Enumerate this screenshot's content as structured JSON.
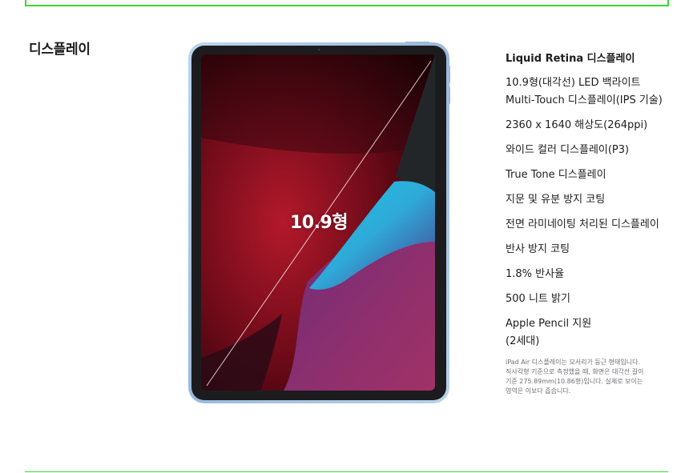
{
  "section": {
    "title": "디스플레이"
  },
  "illustration": {
    "size_label": "10.9형",
    "device_frame_color": "#a9c6e2",
    "bezel_color": "#1c1c1e"
  },
  "specs": {
    "heading": "Liquid Retina 디스플레이",
    "items": [
      {
        "lines": [
          "10.9형(대각선) LED 백라이트",
          "Multi‑Touch 디스플레이(IPS 기술)"
        ]
      },
      {
        "lines": [
          "2360 x 1640 해상도(264ppi)"
        ]
      },
      {
        "lines": [
          "와이드 컬러 디스플레이(P3)"
        ]
      },
      {
        "lines": [
          "True Tone 디스플레이"
        ]
      },
      {
        "lines": [
          "지문 및 유분 방지 코팅"
        ]
      },
      {
        "lines": [
          "전면 라미네이팅 처리된 디스플레이"
        ]
      },
      {
        "lines": [
          "반사 방지 코팅"
        ]
      },
      {
        "lines": [
          "1.8% 반사율"
        ]
      },
      {
        "lines": [
          "500 니트 밝기"
        ]
      },
      {
        "lines": [
          "Apple Pencil 지원",
          "(2세대)"
        ]
      }
    ],
    "footnote_lines": [
      "iPad Air 디스플레이는 모서리가 둥근 형태입니다.",
      "직사각형 기준으로 측정했을 때, 화면은 대각선 길이",
      "기준 275.89mm(10.86형)입니다. 실제로 보이는",
      "영역은 이보다 좁습니다."
    ]
  },
  "colors": {
    "accent_border": "#39d832",
    "text_primary": "#1d1d1f",
    "text_secondary": "#6e6e73"
  }
}
